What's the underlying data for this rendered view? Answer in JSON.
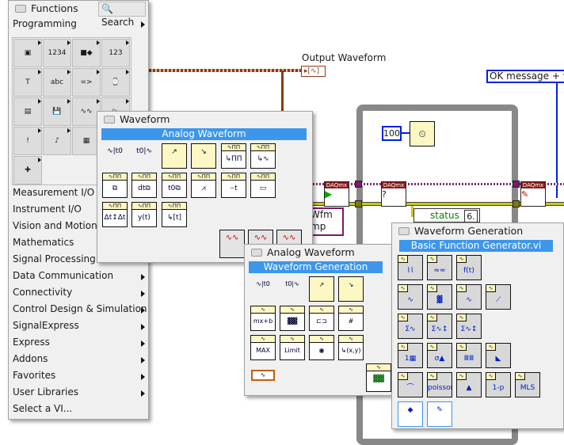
{
  "diagram": {
    "output_label": "Output Waveform",
    "constant": "100",
    "status": "status",
    "num1": "6.",
    "msg": "OK message + wa",
    "wfm_label1": "Wfm",
    "wfm_label2": "mp",
    "daq": "DAQmx",
    "colors": {
      "wire_brown": "#8b3a1a",
      "loop": "#888888",
      "wire_blue": "#0020e0"
    }
  },
  "functions": {
    "title": "Functions",
    "search": "Search",
    "category": "Programming",
    "grid": [
      {
        "icon": "structures-icon",
        "g": "▣"
      },
      {
        "icon": "array-icon",
        "g": "1234"
      },
      {
        "icon": "cluster-icon",
        "g": "■◆"
      },
      {
        "icon": "numeric-icon",
        "g": "123"
      },
      {
        "icon": "boolean-icon",
        "g": "T"
      },
      {
        "icon": "string-icon",
        "g": "abc"
      },
      {
        "icon": "comparison-icon",
        "g": "=>"
      },
      {
        "icon": "timing-icon",
        "g": "⌚"
      },
      {
        "icon": "dialog-icon",
        "g": "▤"
      },
      {
        "icon": "file-io-icon",
        "g": "💾"
      },
      {
        "icon": "waveform-icon",
        "g": "∿∿"
      },
      {
        "icon": "app-control-icon",
        "g": "▷"
      },
      {
        "icon": "synchronization-icon",
        "g": "!"
      },
      {
        "icon": "graphics-sound-icon",
        "g": "♪"
      },
      {
        "icon": "report-icon",
        "g": "▦"
      },
      {
        "icon": "ni-example-icon",
        "g": "✚"
      }
    ],
    "items": [
      {
        "label": "Measurement I/O",
        "arrow": false
      },
      {
        "label": "Instrument I/O",
        "arrow": false
      },
      {
        "label": "Vision and Motion",
        "arrow": false
      },
      {
        "label": "Mathematics",
        "arrow": false
      },
      {
        "label": "Signal Processing",
        "arrow": false
      },
      {
        "label": "Data Communication",
        "arrow": true
      },
      {
        "label": "Connectivity",
        "arrow": true
      },
      {
        "label": "Control Design & Simulation",
        "arrow": true
      },
      {
        "label": "SignalExpress",
        "arrow": true
      },
      {
        "label": "Express",
        "arrow": true
      },
      {
        "label": "Addons",
        "arrow": true
      },
      {
        "label": "Favorites",
        "arrow": true
      },
      {
        "label": "User Libraries",
        "arrow": true
      },
      {
        "label": "Select a VI...",
        "arrow": false
      }
    ]
  },
  "waveform": {
    "title": "Waveform",
    "bar": "Analog Waveform",
    "icons": [
      "get-waveform-components",
      "build-waveform",
      "set-attribute",
      "get-attribute",
      "index-waveform-array",
      "get-waveform-subset",
      "append-waveforms",
      "build-waveform-array",
      "copy-waveform-dt",
      "waveform-min-max",
      "search-waveform",
      "waveform-duration",
      "align-waveform-timestamps",
      "waveform-scaling",
      "get-xy-value"
    ],
    "glyphs": [
      "∿|t0",
      "t0|∿",
      "↗",
      "↘",
      "↳ΠΠ",
      "↳∿",
      "⧉",
      "dt⧉",
      "t0⧉",
      "⩘",
      "⌣t",
      "▭",
      "Δt↕Δt",
      "y(t)",
      "↳[t]"
    ],
    "subs": [
      "analog-waveform-sub",
      "digital-waveform-sub",
      "waveform-file-io-sub"
    ]
  },
  "analog": {
    "title": "Analog Waveform",
    "bar": "Waveform Generation",
    "glyphs": [
      "∿|t0",
      "t0|∿",
      "↗",
      "↘",
      "mx+b",
      "▓▓",
      "⊏⊐",
      "#",
      "MAX MIN",
      "Limit",
      "◉",
      "↳(x,y)"
    ],
    "icons": [
      "get-components",
      "build",
      "set-attr",
      "get-attr",
      "scale-waveform",
      "noise",
      "replace",
      "search",
      "max-min",
      "limit-test",
      "peak",
      "get-xy"
    ]
  },
  "gen": {
    "title": "Waveform Generation",
    "bar": "Basic Function Generator.vi",
    "glyphs": [
      "⌇⌇",
      "≈≈",
      "f(t)",
      "∿",
      "▓",
      "∿",
      "⟋",
      "Σ∿",
      "Σ∿↕",
      "Σ∿↕",
      "1▦",
      "σ▲",
      "ⅢⅢ",
      "◣",
      "⌒",
      "poisson",
      "▲",
      "1-p",
      "MLS",
      "◆",
      "✎"
    ],
    "icons": [
      "basic-function-generator",
      "basic-multitone",
      "formula-waveform",
      "sine-waveform",
      "square-waveform",
      "triangle-waveform",
      "sawtooth-waveform",
      "basic-multitone-waveform",
      "multitone-amplitude",
      "multitone-chirp",
      "uniform-noise",
      "gaussian-noise",
      "periodic-random-noise",
      "inverse-f-noise",
      "gamma-noise",
      "poisson-noise",
      "binomial-noise",
      "bernoulli-noise",
      "mls-sequence",
      "simulate-signal",
      "create-waveform"
    ]
  }
}
